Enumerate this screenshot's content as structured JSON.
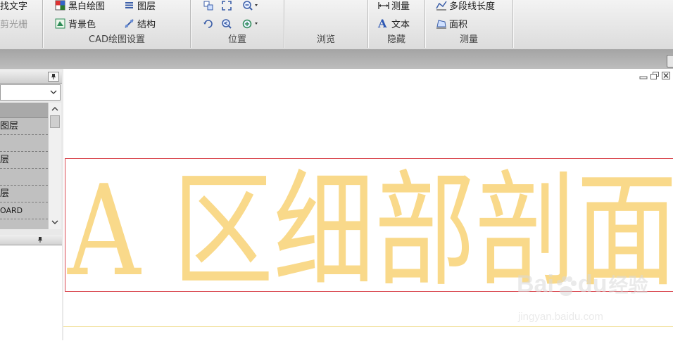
{
  "ribbon": {
    "cad_group": {
      "find_text": "找文字",
      "clip_raster": "剪光栅",
      "black_white": "黑白绘图",
      "background": "背景色",
      "layers": "图层",
      "structure": "结构",
      "label": "CAD绘图设置"
    },
    "position_group": {
      "label": "位置"
    },
    "browse_group": {
      "label": "浏览"
    },
    "hide_group": {
      "measure": "测量",
      "text": "文本",
      "label": "隐藏"
    },
    "measure_group": {
      "polyline_length": "多段线长度",
      "area": "面积",
      "label": "测量"
    }
  },
  "left_panel": {
    "layers": [
      {
        "label": "图层"
      },
      {
        "label": "层"
      },
      {
        "label": "层"
      },
      {
        "label": "OARD"
      }
    ]
  },
  "drawing": {
    "text": "A 区细部剖面",
    "text_color": "#f9d98a",
    "frame_color": "#d8434b"
  },
  "watermark": {
    "brand": "Bai",
    "brand_tail": "du",
    "suffix": "经验",
    "url": "jingyan.baidu.com"
  }
}
